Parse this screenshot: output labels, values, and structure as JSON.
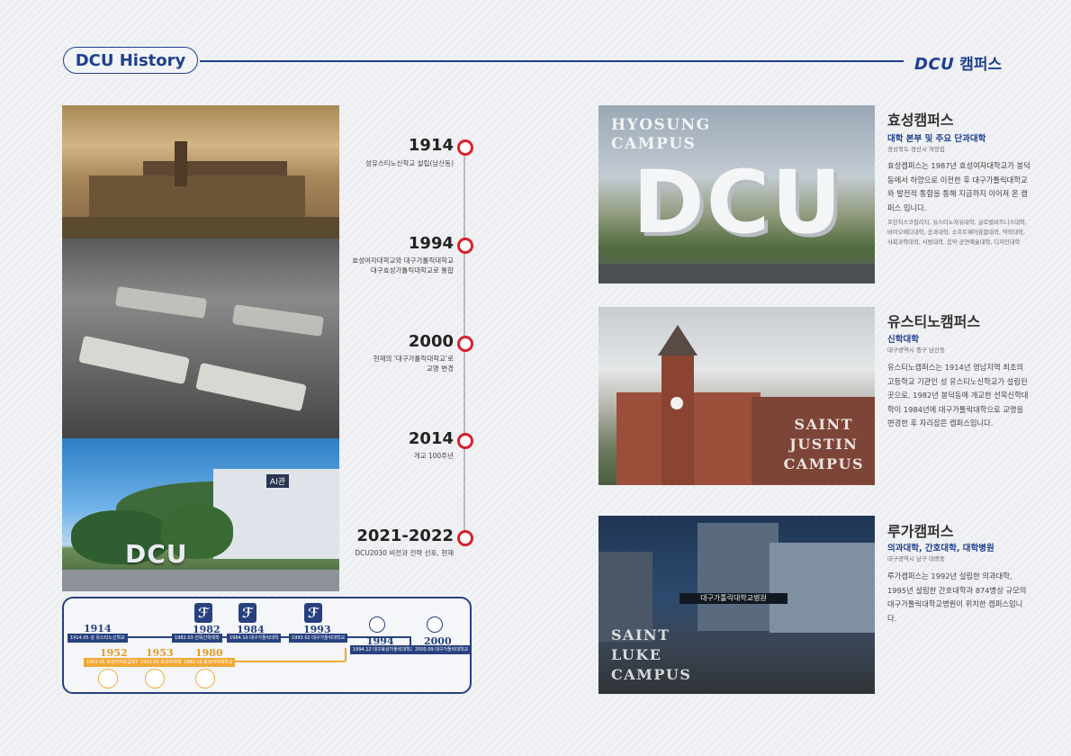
{
  "header": {
    "left_title": "DCU History",
    "brand": "DCU",
    "right_title": "캠퍼스"
  },
  "left_photo": {
    "sign_text": "DCU",
    "building_sign": "AI관"
  },
  "timeline": [
    {
      "year": "1914",
      "desc": [
        "성유스티노신학교 설립(남산동)"
      ]
    },
    {
      "year": "1994",
      "desc": [
        "효성여자대학교와 대구가톨릭대학교",
        "대구효성가톨릭대학교로 통합"
      ]
    },
    {
      "year": "2000",
      "desc": [
        "현재의 '대구가톨릭대학교'로",
        "교명 변경"
      ]
    },
    {
      "year": "2014",
      "desc": [
        "개교 100주년"
      ]
    },
    {
      "year": "2021-2022",
      "desc": [
        "DCU2030 비전과 전략 선포, 현재"
      ]
    }
  ],
  "mini_timeline": {
    "blue": [
      {
        "year": "1914",
        "label": "1914.05 성 유스티노신학교"
      },
      {
        "year": "1982",
        "label": "1982.03 선목신학대학"
      },
      {
        "year": "1984",
        "label": "1984.10 대구가톨릭대학"
      },
      {
        "year": "1993",
        "label": "1993.02 대구가톨릭대학교"
      },
      {
        "year": "1994",
        "label": "1994.12 대구효성가톨릭대학교"
      },
      {
        "year": "2000",
        "label": "2000.09 대구가톨릭대학교"
      }
    ],
    "orange": [
      {
        "year": "1952",
        "label": "1952.05 효성여자초급대학"
      },
      {
        "year": "1953",
        "label": "1953.05 효성여자대학"
      },
      {
        "year": "1980",
        "label": "1980.10 효성여자대학교"
      }
    ]
  },
  "campuses": [
    {
      "photo_title": [
        "HYOSUNG",
        "CAMPUS"
      ],
      "photo_sign": "DCU",
      "name": "효성캠퍼스",
      "sub": "대학 본부 및 주요 단과대학",
      "location": "경상북도 경산시 하양읍",
      "body": "효성캠퍼스는 1987년 효성여자대학교가 봉덕동에서 하양으로 이전한 후 대구가톨릭대학교와 발전적 통합을 통해 지금까지 이어져 온 캠퍼스 입니다.",
      "small": "프란치스코칼리지, 유스티노자유대학, 글로벌비즈니스대학, 바이오메디대학, 공과대학, 소프트웨어융합대학, 약학대학, 사회과학대학, 사범대학, 음악·공연예술대학, 디자인대학"
    },
    {
      "photo_title": [
        "SAINT",
        "JUSTIN",
        "CAMPUS"
      ],
      "name": "유스티노캠퍼스",
      "sub": "신학대학",
      "location": "대구광역시 중구 남산동",
      "body": "유스티노캠퍼스는 1914년 영남지역 최초의 고등학교 기관인 성 유스티노신학교가 설립된 곳으로, 1982년 봉덕동에 개교한 선목신학대학이 1984년에 대구가톨릭대학으로 교명을 변경한 후 자리잡은 캠퍼스입니다."
    },
    {
      "photo_title": [
        "SAINT",
        "LUKE",
        "CAMPUS"
      ],
      "photo_sign": "대구가톨릭대학교병원",
      "name": "루가캠퍼스",
      "sub": "의과대학, 간호대학, 대학병원",
      "location": "대구광역시 남구 대명동",
      "body": "루가캠퍼스는 1992년 설립한 의과대학, 1995년 설립한 간호대학과 874병상 규모의 대구가톨릭대학교병원이 위치한 캠퍼스입니다."
    }
  ],
  "colors": {
    "navy": "#1f3f8f",
    "red": "#d9202c",
    "orange": "#f0a836"
  }
}
